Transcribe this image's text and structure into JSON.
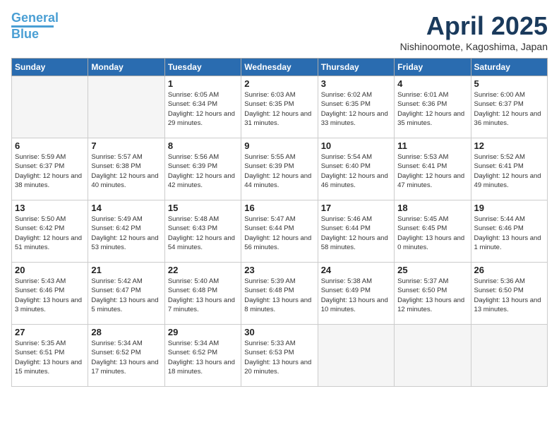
{
  "header": {
    "logo_line1": "General",
    "logo_line2": "Blue",
    "title": "April 2025",
    "location": "Nishinoomote, Kagoshima, Japan"
  },
  "weekdays": [
    "Sunday",
    "Monday",
    "Tuesday",
    "Wednesday",
    "Thursday",
    "Friday",
    "Saturday"
  ],
  "weeks": [
    [
      {
        "day": "",
        "info": ""
      },
      {
        "day": "",
        "info": ""
      },
      {
        "day": "1",
        "info": "Sunrise: 6:05 AM\nSunset: 6:34 PM\nDaylight: 12 hours\nand 29 minutes."
      },
      {
        "day": "2",
        "info": "Sunrise: 6:03 AM\nSunset: 6:35 PM\nDaylight: 12 hours\nand 31 minutes."
      },
      {
        "day": "3",
        "info": "Sunrise: 6:02 AM\nSunset: 6:35 PM\nDaylight: 12 hours\nand 33 minutes."
      },
      {
        "day": "4",
        "info": "Sunrise: 6:01 AM\nSunset: 6:36 PM\nDaylight: 12 hours\nand 35 minutes."
      },
      {
        "day": "5",
        "info": "Sunrise: 6:00 AM\nSunset: 6:37 PM\nDaylight: 12 hours\nand 36 minutes."
      }
    ],
    [
      {
        "day": "6",
        "info": "Sunrise: 5:59 AM\nSunset: 6:37 PM\nDaylight: 12 hours\nand 38 minutes."
      },
      {
        "day": "7",
        "info": "Sunrise: 5:57 AM\nSunset: 6:38 PM\nDaylight: 12 hours\nand 40 minutes."
      },
      {
        "day": "8",
        "info": "Sunrise: 5:56 AM\nSunset: 6:39 PM\nDaylight: 12 hours\nand 42 minutes."
      },
      {
        "day": "9",
        "info": "Sunrise: 5:55 AM\nSunset: 6:39 PM\nDaylight: 12 hours\nand 44 minutes."
      },
      {
        "day": "10",
        "info": "Sunrise: 5:54 AM\nSunset: 6:40 PM\nDaylight: 12 hours\nand 46 minutes."
      },
      {
        "day": "11",
        "info": "Sunrise: 5:53 AM\nSunset: 6:41 PM\nDaylight: 12 hours\nand 47 minutes."
      },
      {
        "day": "12",
        "info": "Sunrise: 5:52 AM\nSunset: 6:41 PM\nDaylight: 12 hours\nand 49 minutes."
      }
    ],
    [
      {
        "day": "13",
        "info": "Sunrise: 5:50 AM\nSunset: 6:42 PM\nDaylight: 12 hours\nand 51 minutes."
      },
      {
        "day": "14",
        "info": "Sunrise: 5:49 AM\nSunset: 6:42 PM\nDaylight: 12 hours\nand 53 minutes."
      },
      {
        "day": "15",
        "info": "Sunrise: 5:48 AM\nSunset: 6:43 PM\nDaylight: 12 hours\nand 54 minutes."
      },
      {
        "day": "16",
        "info": "Sunrise: 5:47 AM\nSunset: 6:44 PM\nDaylight: 12 hours\nand 56 minutes."
      },
      {
        "day": "17",
        "info": "Sunrise: 5:46 AM\nSunset: 6:44 PM\nDaylight: 12 hours\nand 58 minutes."
      },
      {
        "day": "18",
        "info": "Sunrise: 5:45 AM\nSunset: 6:45 PM\nDaylight: 13 hours\nand 0 minutes."
      },
      {
        "day": "19",
        "info": "Sunrise: 5:44 AM\nSunset: 6:46 PM\nDaylight: 13 hours\nand 1 minute."
      }
    ],
    [
      {
        "day": "20",
        "info": "Sunrise: 5:43 AM\nSunset: 6:46 PM\nDaylight: 13 hours\nand 3 minutes."
      },
      {
        "day": "21",
        "info": "Sunrise: 5:42 AM\nSunset: 6:47 PM\nDaylight: 13 hours\nand 5 minutes."
      },
      {
        "day": "22",
        "info": "Sunrise: 5:40 AM\nSunset: 6:48 PM\nDaylight: 13 hours\nand 7 minutes."
      },
      {
        "day": "23",
        "info": "Sunrise: 5:39 AM\nSunset: 6:48 PM\nDaylight: 13 hours\nand 8 minutes."
      },
      {
        "day": "24",
        "info": "Sunrise: 5:38 AM\nSunset: 6:49 PM\nDaylight: 13 hours\nand 10 minutes."
      },
      {
        "day": "25",
        "info": "Sunrise: 5:37 AM\nSunset: 6:50 PM\nDaylight: 13 hours\nand 12 minutes."
      },
      {
        "day": "26",
        "info": "Sunrise: 5:36 AM\nSunset: 6:50 PM\nDaylight: 13 hours\nand 13 minutes."
      }
    ],
    [
      {
        "day": "27",
        "info": "Sunrise: 5:35 AM\nSunset: 6:51 PM\nDaylight: 13 hours\nand 15 minutes."
      },
      {
        "day": "28",
        "info": "Sunrise: 5:34 AM\nSunset: 6:52 PM\nDaylight: 13 hours\nand 17 minutes."
      },
      {
        "day": "29",
        "info": "Sunrise: 5:34 AM\nSunset: 6:52 PM\nDaylight: 13 hours\nand 18 minutes."
      },
      {
        "day": "30",
        "info": "Sunrise: 5:33 AM\nSunset: 6:53 PM\nDaylight: 13 hours\nand 20 minutes."
      },
      {
        "day": "",
        "info": ""
      },
      {
        "day": "",
        "info": ""
      },
      {
        "day": "",
        "info": ""
      }
    ]
  ]
}
